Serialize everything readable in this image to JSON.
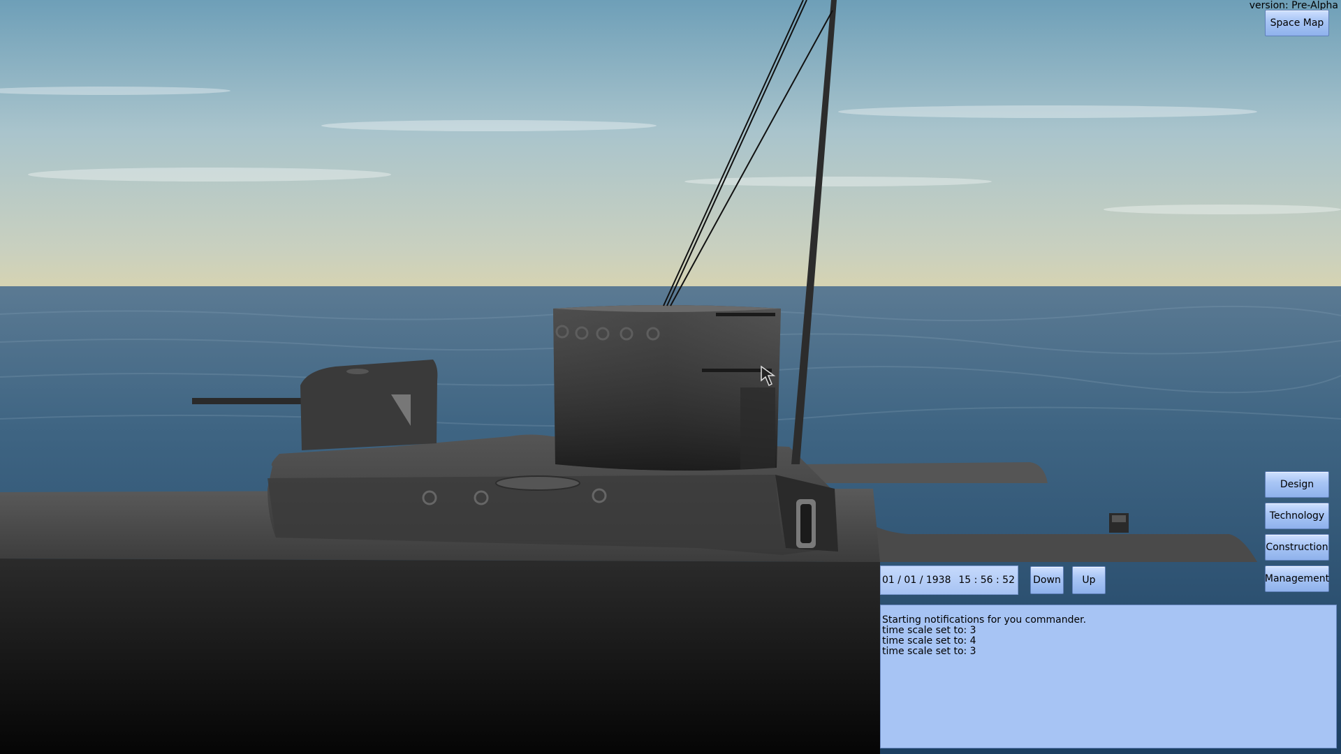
{
  "version_text": "version: Pre-Alpha",
  "buttons": {
    "space_map": "Space Map",
    "design": "Design",
    "technology": "Technology",
    "construction": "Construction",
    "management": "Management",
    "time_down": "Down",
    "time_up": "Up"
  },
  "clock": {
    "date": "01 / 01 / 1938",
    "time": "15 : 56 : 52"
  },
  "notifications": [
    "Starting notifications for you commander.",
    "time scale set to: 3",
    "time scale set to: 4",
    "time scale set to: 3"
  ],
  "colors": {
    "ui_button": "#a9c6f5",
    "panel": "#a7c4f4",
    "hull": "#3a3a3a"
  }
}
